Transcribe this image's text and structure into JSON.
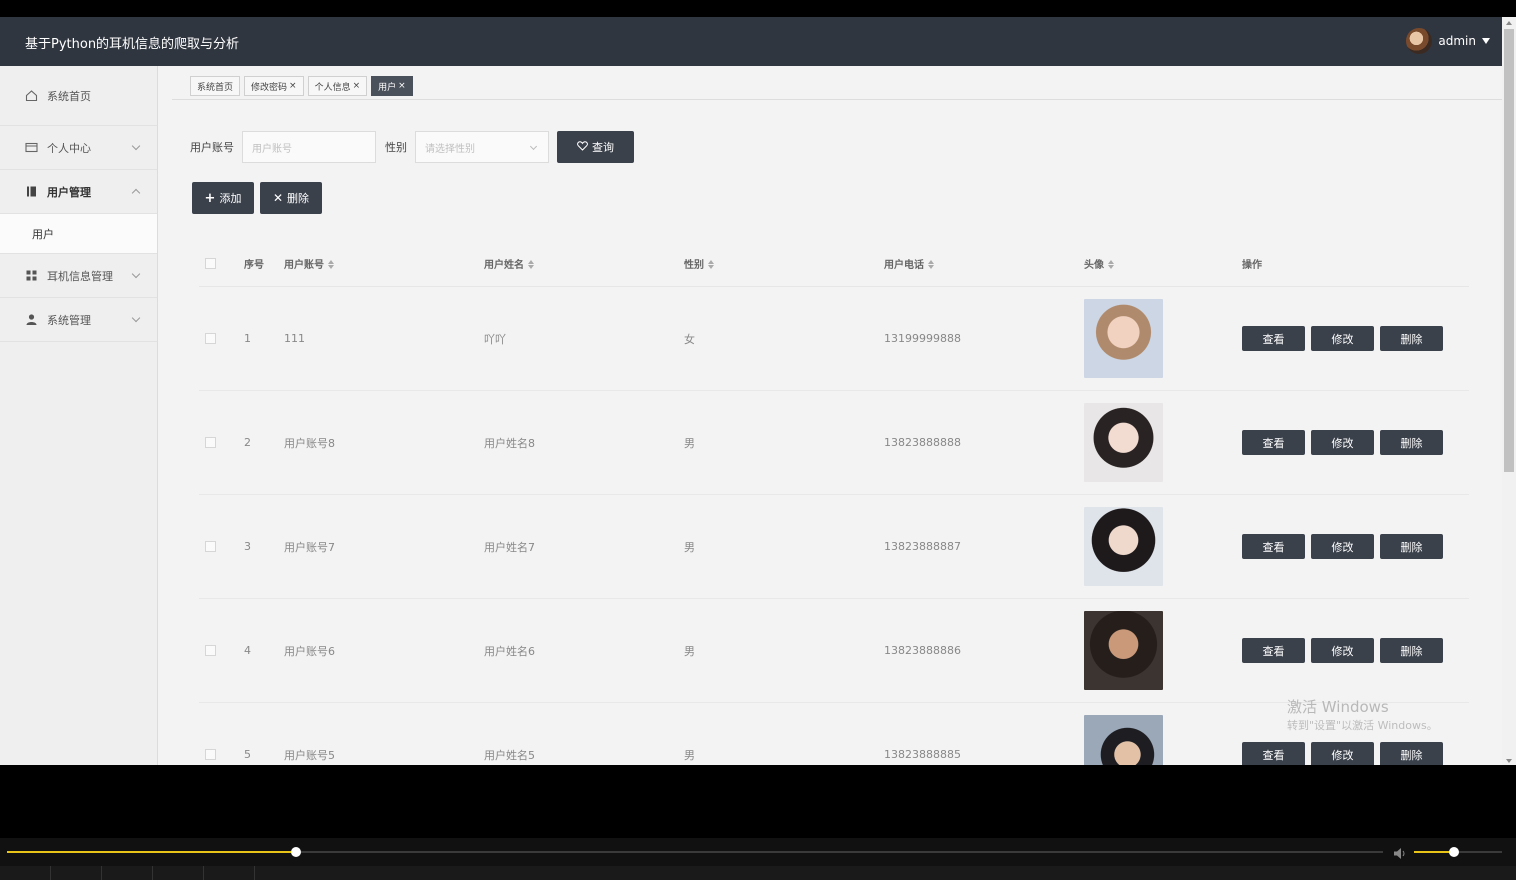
{
  "app": {
    "title": "基于Python的耳机信息的爬取与分析",
    "user": "admin"
  },
  "sidebar": {
    "items": [
      {
        "label": "系统首页",
        "icon": "home-icon"
      },
      {
        "label": "个人中心",
        "icon": "card-icon"
      },
      {
        "label": "用户管理",
        "icon": "book-icon"
      },
      {
        "label": "用户",
        "icon": ""
      },
      {
        "label": "耳机信息管理",
        "icon": "grid-icon"
      },
      {
        "label": "系统管理",
        "icon": "person-icon"
      }
    ]
  },
  "tabs": [
    {
      "label": "系统首页",
      "close": ""
    },
    {
      "label": "修改密码",
      "close": "×"
    },
    {
      "label": "个人信息",
      "close": "×"
    },
    {
      "label": "用户",
      "close": "×"
    }
  ],
  "search": {
    "account_label": "用户账号",
    "account_placeholder": "用户账号",
    "sex_label": "性别",
    "sex_placeholder": "请选择性别",
    "query_button": "查询"
  },
  "actions": {
    "add": "添加",
    "delete": "删除"
  },
  "table": {
    "headers": [
      "序号",
      "用户账号",
      "用户姓名",
      "性别",
      "用户电话",
      "头像",
      "操作"
    ],
    "rows": [
      {
        "idx": "1",
        "account": "111",
        "name": "吖吖",
        "sex": "女",
        "phone": "13199999888"
      },
      {
        "idx": "2",
        "account": "用户账号8",
        "name": "用户姓名8",
        "sex": "男",
        "phone": "13823888888"
      },
      {
        "idx": "3",
        "account": "用户账号7",
        "name": "用户姓名7",
        "sex": "男",
        "phone": "13823888887"
      },
      {
        "idx": "4",
        "account": "用户账号6",
        "name": "用户姓名6",
        "sex": "男",
        "phone": "13823888886"
      },
      {
        "idx": "5",
        "account": "用户账号5",
        "name": "用户姓名5",
        "sex": "男",
        "phone": "13823888885"
      }
    ],
    "ops": {
      "view": "查看",
      "edit": "修改",
      "delete": "删除"
    }
  },
  "watermark": {
    "line1": "激活 Windows",
    "line2": "转到\"设置\"以激活 Windows。"
  },
  "player": {
    "progress": 0.21,
    "volume": 0.45
  },
  "colors": {
    "topbar": "#303640",
    "button": "#3b414b",
    "accent": "#e8c318"
  }
}
